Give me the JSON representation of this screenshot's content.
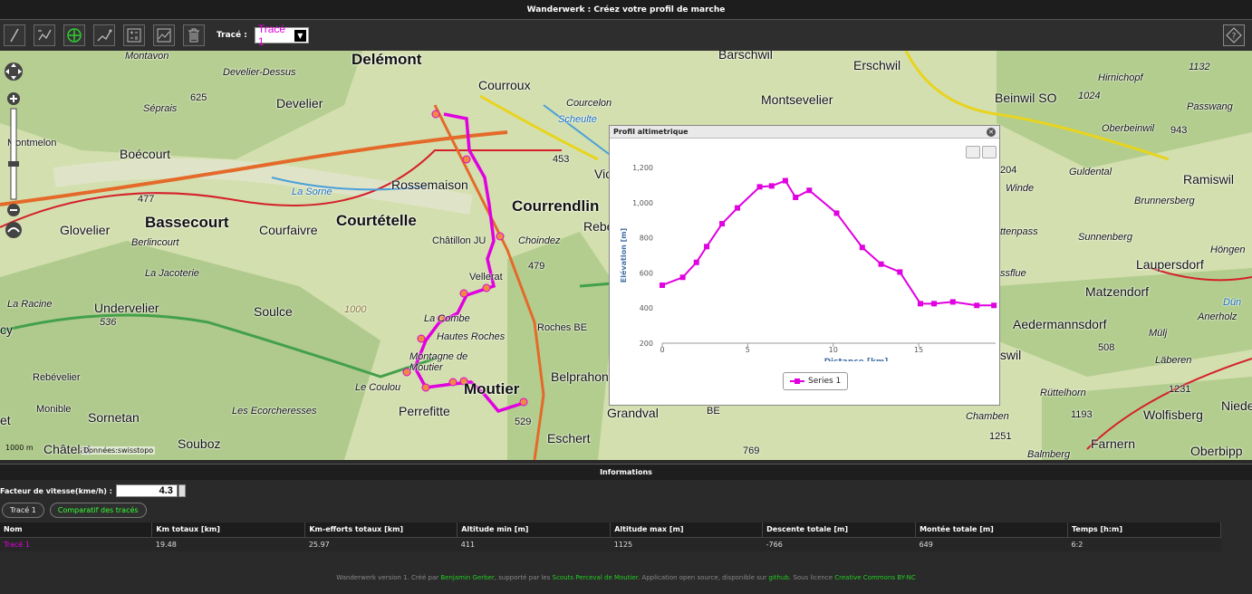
{
  "app": {
    "title": "Wanderwerk : Créez votre profil de marche"
  },
  "toolbar": {
    "trace_label": "Tracé :",
    "trace_selected": "Tracé 1",
    "buttons": [
      "pencil-icon",
      "undo-icon",
      "add-point-icon",
      "edit-path-icon",
      "calculator-icon",
      "chart-icon",
      "trash-icon"
    ]
  },
  "map": {
    "copyright": "Données:swisstopo",
    "scale": "1000 m",
    "places": [
      "Delémont",
      "Courroux",
      "Courcelon",
      "Montavon",
      "Develier-Dessus",
      "Develier",
      "Séprais",
      "625",
      "Montmelon",
      "Boécourt",
      "Bassecourt",
      "Glovelier",
      "Berlincourt",
      "477",
      "La Sorne",
      "Rossemaison",
      "Courtételle",
      "Courfaivre",
      "Courrendlin",
      "Châtillon JU",
      "Choindez",
      "Vellerat",
      "479",
      "La Jacoterie",
      "La Racine",
      "Undervelier",
      "536",
      "Soulce",
      "1000",
      "La Combe",
      "Hautes Roches",
      "Roches BE",
      "Montagne de Moutier",
      "Le Coulou",
      "Rebévelier",
      "Monible",
      "Sornetan",
      "Les Ecorcheresses",
      "Perrefitte",
      "Moutier",
      "529",
      "Belprahon",
      "Grandval",
      "BE",
      "Eschert",
      "Souboz",
      "Châtelat",
      "453",
      "Vic",
      "Rebe",
      "Barschwil",
      "Erschwil",
      "Montsevelier",
      "Beinwil SO",
      "1024",
      "Hirnichopf",
      "Oberbeinwil",
      "943",
      "1132",
      "Passwang",
      "204",
      "Ramiswil",
      "Brunnersberg",
      "Guldental",
      "Winde",
      "ttenpass",
      "Höngen",
      "Laupersdorf",
      "Sunnenberg",
      "ssflue",
      "Matzendorf",
      "Dün",
      "Aedermannsdorf",
      "Anerholz",
      "tswil",
      "Mülj",
      "508",
      "Läberen",
      "Rüttelhorn",
      "1231",
      "1193",
      "Wolfisberg",
      "Nieder",
      "Chamben",
      "1251",
      "Farnern",
      "Oberbipp",
      "769",
      "Balmberg",
      "cy",
      "et",
      "Scheulte"
    ]
  },
  "profile": {
    "title": "Profil altimetrique",
    "legend": "Series 1"
  },
  "chart_data": {
    "type": "line",
    "xlabel": "Distance [km]",
    "ylabel": "Elévation [m]",
    "xlim": [
      0,
      19.5
    ],
    "ylim": [
      200,
      1200
    ],
    "x_ticks": [
      0,
      5,
      10,
      15
    ],
    "y_ticks": [
      200,
      400,
      600,
      800,
      1000,
      1200
    ],
    "y_tick_labels": [
      "200",
      "400",
      "600",
      "800",
      "1,000",
      "1,200"
    ],
    "series": [
      {
        "name": "Series 1",
        "color": "#e000e0",
        "x": [
          0,
          1.2,
          2,
          2.6,
          3.5,
          4.4,
          5.7,
          6.4,
          7.2,
          7.8,
          8.6,
          10.2,
          11.7,
          12.8,
          13.9,
          15.1,
          15.9,
          17,
          18.4,
          19.4
        ],
        "y": [
          530,
          575,
          660,
          750,
          880,
          970,
          1090,
          1095,
          1125,
          1030,
          1070,
          940,
          745,
          650,
          605,
          425,
          425,
          435,
          415,
          415
        ]
      }
    ]
  },
  "info": {
    "title": "Informations",
    "speed_label": "Facteur de vitesse(kme/h) :",
    "speed_value": "4.3",
    "tabs": [
      "Tracé 1",
      "Comparatif des tracés"
    ],
    "columns": [
      "Nom",
      "Km totaux [km]",
      "Km-efforts totaux [km]",
      "Altitude min [m]",
      "Altitude max [m]",
      "Descente totale [m]",
      "Montée totale [m]",
      "Temps [h:m]"
    ],
    "rows": [
      [
        "Tracé 1",
        "19.48",
        "25.97",
        "411",
        "1125",
        "-766",
        "649",
        "6:2"
      ]
    ]
  },
  "footer": {
    "part1": "Wanderwerk version 1. Créé par ",
    "author": "Benjamin Gerber",
    "part2": ", supporté par les ",
    "scouts": "Scouts Perceval de Moutier",
    "part3": ". Application open source, disponible sur ",
    "github": "github",
    "part4": ". Sous licence ",
    "license": "Creative Commons BY-NC"
  },
  "colors": {
    "accent": "#e000e0",
    "link": "#22cc22"
  }
}
